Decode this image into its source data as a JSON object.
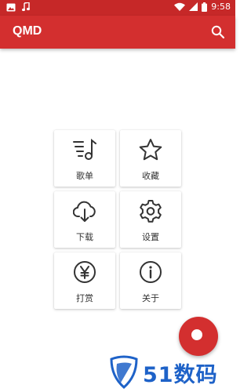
{
  "status_bar": {
    "time": "9:58",
    "icons": [
      "image-icon",
      "music-icon",
      "wifi-icon",
      "signal-icon",
      "battery-icon"
    ]
  },
  "app_bar": {
    "title": "QMD",
    "search_icon": "search-icon"
  },
  "menu": [
    {
      "label": "歌单",
      "icon": "playlist-icon"
    },
    {
      "label": "收藏",
      "icon": "star-icon"
    },
    {
      "label": "下载",
      "icon": "cloud-download-icon"
    },
    {
      "label": "设置",
      "icon": "gear-icon"
    },
    {
      "label": "打赏",
      "icon": "yen-icon"
    },
    {
      "label": "关于",
      "icon": "info-icon"
    }
  ],
  "watermark": {
    "text": "51数码"
  },
  "colors": {
    "primary": "#d32f2f",
    "primary_dark": "#c62828",
    "icon": "#333333",
    "watermark_blue": "#1e62c8"
  }
}
